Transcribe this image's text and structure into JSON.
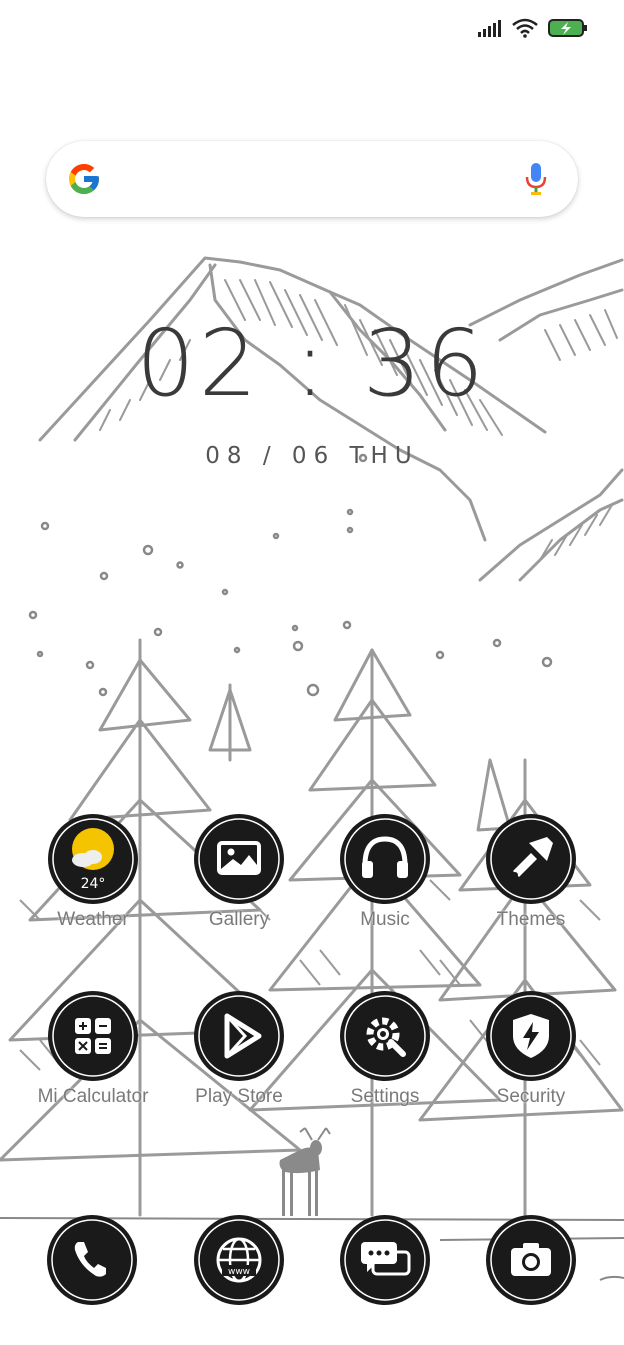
{
  "status_bar": {
    "signal_icon": "cellular-signal-icon",
    "wifi_icon": "wifi-icon",
    "battery_icon": "battery-charging-icon",
    "battery_color": "#4caf50"
  },
  "search": {
    "logo_icon": "google-logo-icon",
    "mic_icon": "microphone-icon"
  },
  "clock": {
    "time": "02 : 36",
    "date": "08 / 06 THU"
  },
  "apps": [
    {
      "label": "Weather",
      "icon": "weather-icon",
      "temperature": "24°"
    },
    {
      "label": "Gallery",
      "icon": "gallery-icon"
    },
    {
      "label": "Music",
      "icon": "headphones-icon"
    },
    {
      "label": "Themes",
      "icon": "paintbrush-icon"
    },
    {
      "label": "Mi Calculator",
      "icon": "calculator-icon"
    },
    {
      "label": "Play Store",
      "icon": "play-store-icon"
    },
    {
      "label": "Settings",
      "icon": "settings-gear-icon"
    },
    {
      "label": "Security",
      "icon": "shield-icon"
    }
  ],
  "dock": [
    {
      "icon": "phone-icon"
    },
    {
      "icon": "browser-globe-icon",
      "text": "www"
    },
    {
      "icon": "messages-icon"
    },
    {
      "icon": "camera-icon"
    }
  ],
  "colors": {
    "icon_badge": "#1a1a1a",
    "sun": "#f5c400",
    "sketch": "#9a9a9a"
  }
}
